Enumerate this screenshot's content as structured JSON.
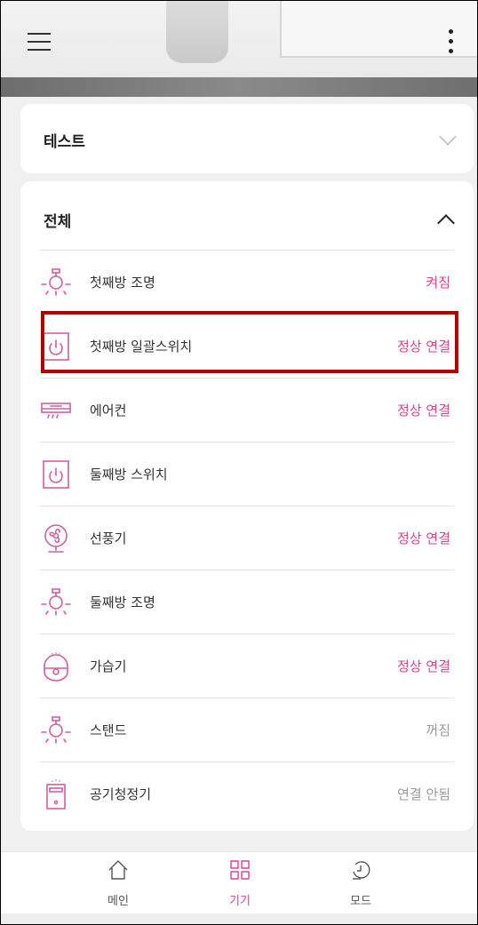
{
  "colors": {
    "accent": "#d9438b",
    "status_off": "#9a9a9a",
    "icon_pink": "#d45ea0"
  },
  "header": {
    "menu_icon": "hamburger-icon",
    "more_icon": "kebab-icon"
  },
  "groups": [
    {
      "title": "테스트",
      "expanded": false
    },
    {
      "title": "전체",
      "expanded": true
    }
  ],
  "devices": [
    {
      "name": "첫째방 조명",
      "icon": "light-bulb-icon",
      "status": "켜짐",
      "status_type": "accent"
    },
    {
      "name": "첫째방 일괄스위치",
      "icon": "power-switch-icon",
      "status": "정상 연결",
      "status_type": "accent"
    },
    {
      "name": "에어컨",
      "icon": "air-conditioner-icon",
      "status": "정상 연결",
      "status_type": "accent"
    },
    {
      "name": "둘째방 스위치",
      "icon": "power-switch-icon",
      "status": "",
      "status_type": "accent"
    },
    {
      "name": "선풍기",
      "icon": "fan-icon",
      "status": "정상 연결",
      "status_type": "accent"
    },
    {
      "name": "둘째방 조명",
      "icon": "light-bulb-icon",
      "status": "",
      "status_type": "accent"
    },
    {
      "name": "가습기",
      "icon": "humidifier-icon",
      "status": "정상 연결",
      "status_type": "accent"
    },
    {
      "name": "스탠드",
      "icon": "light-bulb-icon",
      "status": "꺼짐",
      "status_type": "muted"
    },
    {
      "name": "공기청정기",
      "icon": "air-purifier-icon",
      "status": "연결 안됨",
      "status_type": "muted"
    }
  ],
  "nav": [
    {
      "label": "메인",
      "icon": "home-icon",
      "active": false
    },
    {
      "label": "기기",
      "icon": "grid-icon",
      "active": true
    },
    {
      "label": "모드",
      "icon": "clock-icon",
      "active": false
    }
  ]
}
